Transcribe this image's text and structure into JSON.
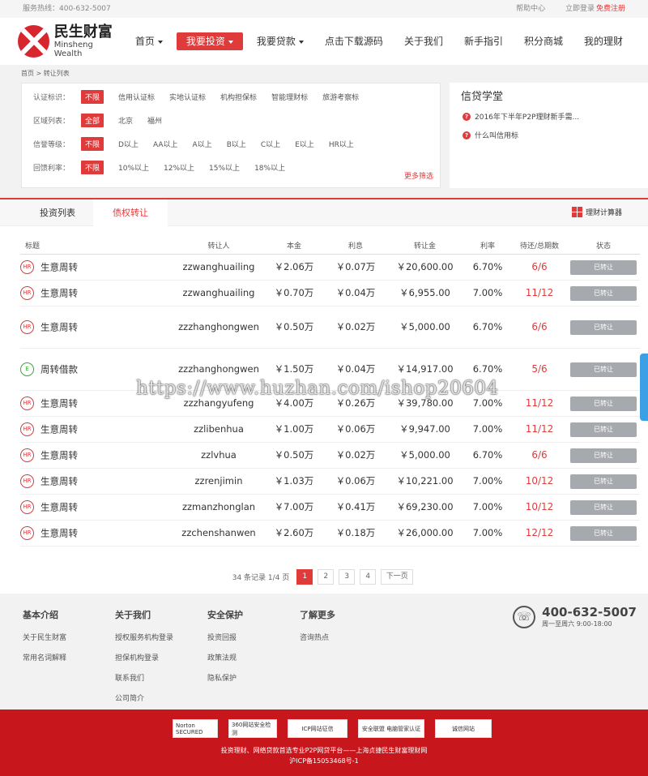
{
  "topbar": {
    "hotline": "服务热线：400-632-5007",
    "help": "帮助中心",
    "login": "立即登录",
    "register": "免费注册"
  },
  "logo": {
    "cn": "民生财富",
    "en": "Minsheng Wealth"
  },
  "nav": [
    "首页",
    "我要投资",
    "我要贷款",
    "点击下载源码",
    "关于我们",
    "新手指引",
    "积分商城",
    "我的理财"
  ],
  "breadcrumb": "首页 > 转让列表",
  "filters": [
    {
      "label": "认证标识：",
      "options": [
        "不限",
        "信用认证标",
        "实地认证标",
        "机构担保标",
        "智能理财标",
        "旅游考察标"
      ]
    },
    {
      "label": "区域列表：",
      "options": [
        "全部",
        "北京",
        "福州"
      ]
    },
    {
      "label": "信誉等级：",
      "options": [
        "不限",
        "D以上",
        "AA以上",
        "A以上",
        "B以上",
        "C以上",
        "E以上",
        "HR以上"
      ]
    },
    {
      "label": "回馈利率：",
      "options": [
        "不限",
        "10%以上",
        "12%以上",
        "15%以上",
        "18%以上"
      ]
    }
  ],
  "more_filter": "更多筛选",
  "school": {
    "title": "信贷学堂",
    "items": [
      "2016年下半年P2P理财新手需...",
      "什么叫信用标"
    ]
  },
  "tabs": [
    "投资列表",
    "债权转让"
  ],
  "calculator": "理财计算器",
  "table": {
    "headers": [
      "标题",
      "转让人",
      "本金",
      "利息",
      "转让金",
      "利率",
      "待还/总期数",
      "状态"
    ],
    "rows": [
      {
        "badge": "HR",
        "title": "生意周转",
        "user": "zzwanghuailing",
        "principal": "￥2.06万",
        "interest": "￥0.07万",
        "amount": "￥20,600.00",
        "rate": "6.70%",
        "period": "6/6",
        "status": "已转让"
      },
      {
        "badge": "HR",
        "title": "生意周转",
        "user": "zzwanghuailing",
        "principal": "￥0.70万",
        "interest": "￥0.04万",
        "amount": "￥6,955.00",
        "rate": "7.00%",
        "period": "11/12",
        "status": "已转让"
      },
      {
        "badge": "HR",
        "title": "生意周转",
        "user": "zzzhanghongwen",
        "principal": "￥0.50万",
        "interest": "￥0.02万",
        "amount": "￥5,000.00",
        "rate": "6.70%",
        "period": "6/6",
        "status": "已转让"
      },
      {
        "badge": "E",
        "title": "周转借款",
        "user": "zzzhanghongwen",
        "principal": "￥1.50万",
        "interest": "￥0.04万",
        "amount": "￥14,917.00",
        "rate": "6.70%",
        "period": "5/6",
        "status": "已转让"
      },
      {
        "badge": "HR",
        "title": "生意周转",
        "user": "zzzhangyufeng",
        "principal": "￥4.00万",
        "interest": "￥0.26万",
        "amount": "￥39,780.00",
        "rate": "7.00%",
        "period": "11/12",
        "status": "已转让"
      },
      {
        "badge": "HR",
        "title": "生意周转",
        "user": "zzlibenhua",
        "principal": "￥1.00万",
        "interest": "￥0.06万",
        "amount": "￥9,947.00",
        "rate": "7.00%",
        "period": "11/12",
        "status": "已转让"
      },
      {
        "badge": "HR",
        "title": "生意周转",
        "user": "zzlvhua",
        "principal": "￥0.50万",
        "interest": "￥0.02万",
        "amount": "￥5,000.00",
        "rate": "6.70%",
        "period": "6/6",
        "status": "已转让"
      },
      {
        "badge": "HR",
        "title": "生意周转",
        "user": "zzrenjimin",
        "principal": "￥1.03万",
        "interest": "￥0.06万",
        "amount": "￥10,221.00",
        "rate": "7.00%",
        "period": "10/12",
        "status": "已转让"
      },
      {
        "badge": "HR",
        "title": "生意周转",
        "user": "zzmanzhonglan",
        "principal": "￥7.00万",
        "interest": "￥0.41万",
        "amount": "￥69,230.00",
        "rate": "7.00%",
        "period": "10/12",
        "status": "已转让"
      },
      {
        "badge": "HR",
        "title": "生意周转",
        "user": "zzchenshanwen",
        "principal": "￥2.60万",
        "interest": "￥0.18万",
        "amount": "￥26,000.00",
        "rate": "7.00%",
        "period": "12/12",
        "status": "已转让"
      }
    ]
  },
  "pager": {
    "info": "34 条记录 1/4 页",
    "pages": [
      "1",
      "2",
      "3",
      "4"
    ],
    "next": "下一页"
  },
  "footer": {
    "cols": [
      {
        "title": "基本介绍",
        "items": [
          "关于民生财富",
          "常用名词解释"
        ]
      },
      {
        "title": "关于我们",
        "items": [
          "授权服务机构登录",
          "担保机构登录",
          "联系我们",
          "公司简介"
        ]
      },
      {
        "title": "安全保护",
        "items": [
          "投资回报",
          "政策法规",
          "隐私保护"
        ]
      },
      {
        "title": "了解更多",
        "items": [
          "咨询热点"
        ]
      }
    ],
    "hotline": "400-632-5007",
    "hours": "周一至周六 9:00-18:00"
  },
  "certs": [
    "Norton SECURED",
    "360网站安全检测",
    "ICP网站征信",
    "安全联盟 电脑管家认证",
    "诚信网站"
  ],
  "copyright": [
    "投资理财、网络贷款首选专业P2P网贷平台——上海贞捷民生财富理财网",
    "沪ICP备15053468号-1"
  ],
  "watermark": "https://www.huzhan.com/ishop20604"
}
